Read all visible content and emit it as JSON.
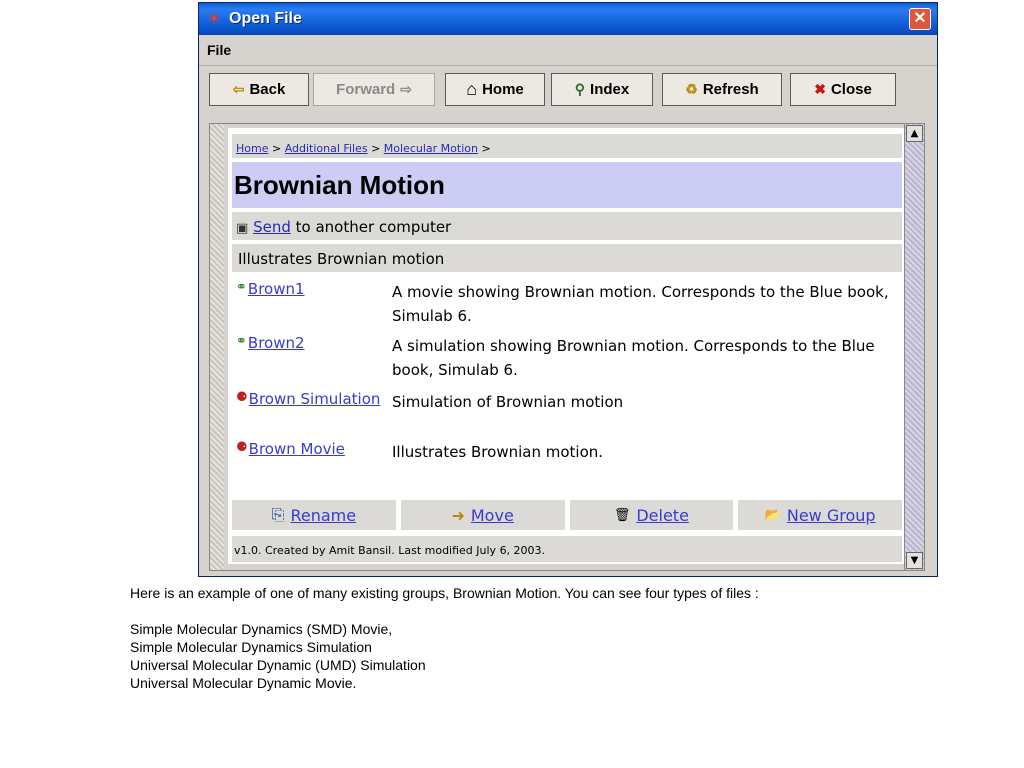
{
  "window": {
    "title": "Open File",
    "close_glyph": "✕"
  },
  "menu": {
    "file": "File"
  },
  "toolbar": {
    "back": "Back",
    "forward": "Forward",
    "home": "Home",
    "index": "Index",
    "refresh": "Refresh",
    "close": "Close"
  },
  "icons": {
    "back": "⇦",
    "forward": "⇨",
    "home": "⌂",
    "index": "⚲",
    "refresh": "♻",
    "close": "✖",
    "send": "▣",
    "smd": "⚭",
    "umd": "⚈",
    "rename": "⎘",
    "move": "➜",
    "delete": "🗑",
    "new_group": "📂"
  },
  "breadcrumb": {
    "home": "Home",
    "additional_files": "Additional Files",
    "molecular_motion": "Molecular Motion",
    "separator": ">"
  },
  "page": {
    "title": "Brownian Motion",
    "send_link": "Send",
    "send_rest": " to another computer",
    "description": "Illustrates Brownian motion",
    "footer": "v1.0. Created by Amit Bansil. Last modified July 6, 2003."
  },
  "files": [
    {
      "name": "Brown1",
      "description": "A movie showing Brownian motion. Corresponds to the Blue book, Simulab 6.",
      "kind": "smd"
    },
    {
      "name": "Brown2",
      "description": "A simulation showing Brownian motion. Corresponds to the Blue book, Simulab 6.",
      "kind": "smd"
    },
    {
      "name": "Brown Simulation",
      "description": "Simulation of Brownian motion",
      "kind": "umd"
    },
    {
      "name": "Brown Movie",
      "description": "Illustrates Brownian motion.",
      "kind": "umd"
    }
  ],
  "actions": {
    "rename": "Rename",
    "move": "Move",
    "delete": "Delete",
    "new_group": "New Group"
  },
  "caption": {
    "intro": "Here is an example of one of many existing groups, Brownian Motion.  You can see four types of files :",
    "line1": "Simple Molecular Dynamics (SMD) Movie,",
    "line2": "Simple Molecular Dynamics Simulation",
    "line3": "Universal Molecular Dynamic (UMD) Simulation",
    "line4": "Universal Molecular Dynamic Movie."
  },
  "colors": {
    "titlebar": "#0a5fd8",
    "title_band": "#ccccf4",
    "link": "#3a3ad0"
  }
}
